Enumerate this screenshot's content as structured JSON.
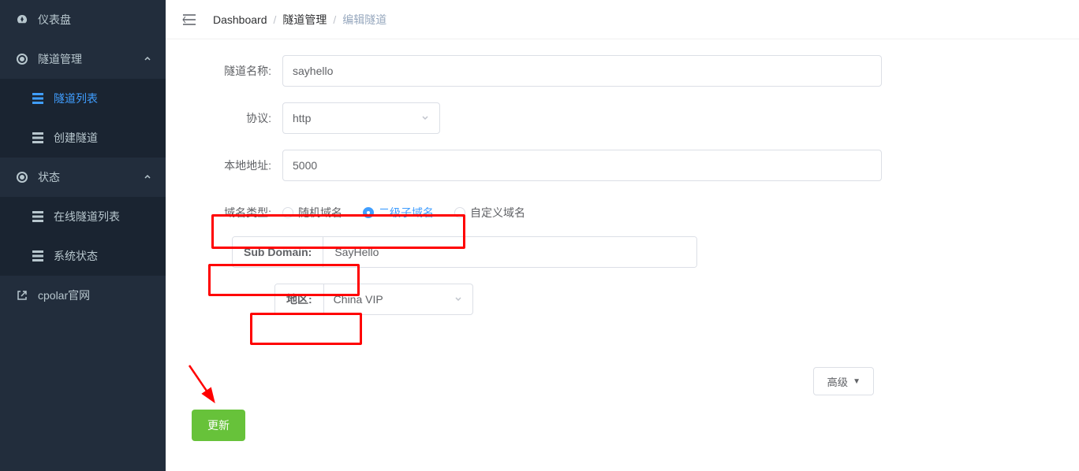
{
  "sidebar": {
    "items": [
      {
        "label": "仪表盘",
        "icon": "dashboard-icon"
      },
      {
        "label": "隧道管理",
        "icon": "tunnel-icon",
        "expandable": true
      },
      {
        "label": "隧道列表",
        "icon": "list-icon",
        "sub": true,
        "active": true
      },
      {
        "label": "创建隧道",
        "icon": "list-icon",
        "sub": true
      },
      {
        "label": "状态",
        "icon": "status-icon",
        "expandable": true
      },
      {
        "label": "在线隧道列表",
        "icon": "list-icon",
        "sub": true
      },
      {
        "label": "系统状态",
        "icon": "list-icon",
        "sub": true
      },
      {
        "label": "cpolar官网",
        "icon": "external-icon"
      }
    ]
  },
  "breadcrumb": {
    "items": [
      "Dashboard",
      "隧道管理",
      "编辑隧道"
    ]
  },
  "form": {
    "tunnel_name_label": "隧道名称:",
    "tunnel_name_value": "sayhello",
    "protocol_label": "协议:",
    "protocol_value": "http",
    "local_addr_label": "本地地址:",
    "local_addr_value": "5000",
    "domain_type_label": "域名类型:",
    "domain_type_options": {
      "random": "随机域名",
      "subdomain": "二级子域名",
      "custom": "自定义域名"
    },
    "domain_type_selected": "subdomain",
    "sub_domain_label": "Sub Domain:",
    "sub_domain_value": "SayHello",
    "region_label": "地区:",
    "region_value": "China VIP",
    "advanced_label": "高级",
    "update_label": "更新"
  }
}
